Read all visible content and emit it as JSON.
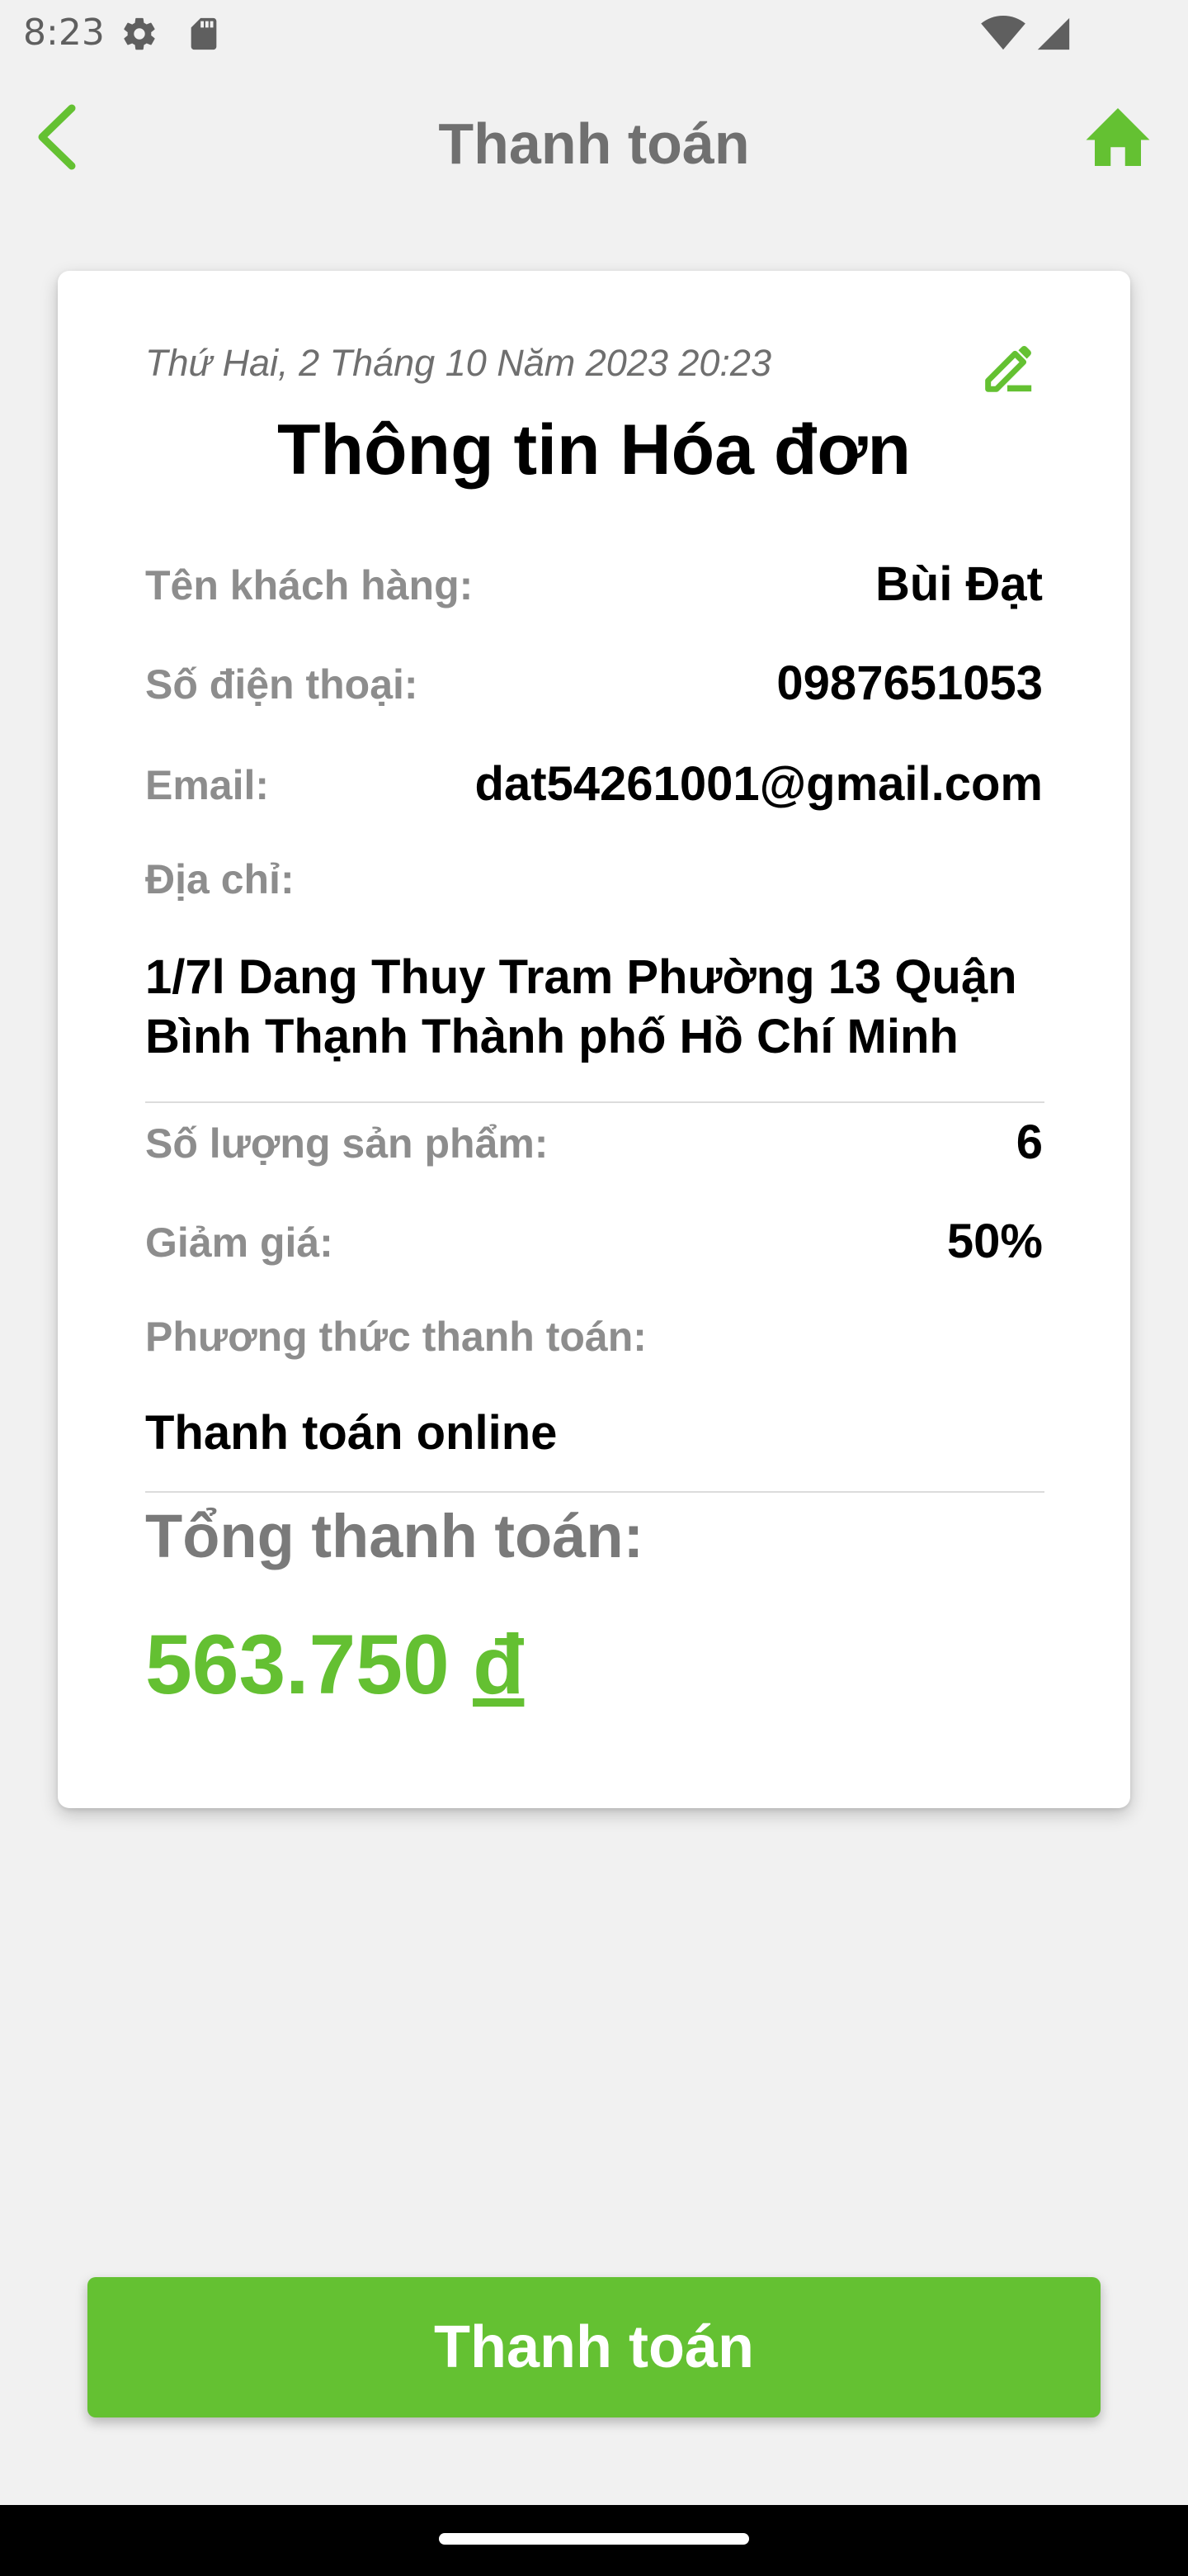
{
  "status_bar": {
    "time": "8:23",
    "icons": [
      "gear-icon",
      "sd-card-icon",
      "wifi-icon",
      "signal-icon"
    ]
  },
  "header": {
    "title": "Thanh toán",
    "back_icon": "chevron-left-icon",
    "home_icon": "home-icon",
    "accent_color": "#64c132"
  },
  "invoice": {
    "date": "Thứ Hai, 2 Tháng 10 Năm 2023 20:23",
    "edit_icon": "edit-pencil-icon",
    "title": "Thông tin Hóa đơn",
    "customer_name_label": "Tên khách hàng:",
    "customer_name": "Bùi Đạt",
    "phone_label": "Số điện thoại:",
    "phone": "0987651053",
    "email_label": "Email:",
    "email": "dat54261001@gmail.com",
    "address_label": "Địa chỉ:",
    "address": "1/7l Dang Thuy Tram Phường 13 Quận Bình Thạnh Thành phố Hồ Chí Minh",
    "quantity_label": "Số lượng sản phẩm:",
    "quantity": "6",
    "discount_label": "Giảm giá:",
    "discount": "50%",
    "payment_method_label": "Phương thức thanh toán:",
    "payment_method": "Thanh toán online",
    "total_label": "Tổng thanh toán:",
    "total_amount": "563.750",
    "currency": "đ"
  },
  "actions": {
    "pay_label": "Thanh toán"
  }
}
